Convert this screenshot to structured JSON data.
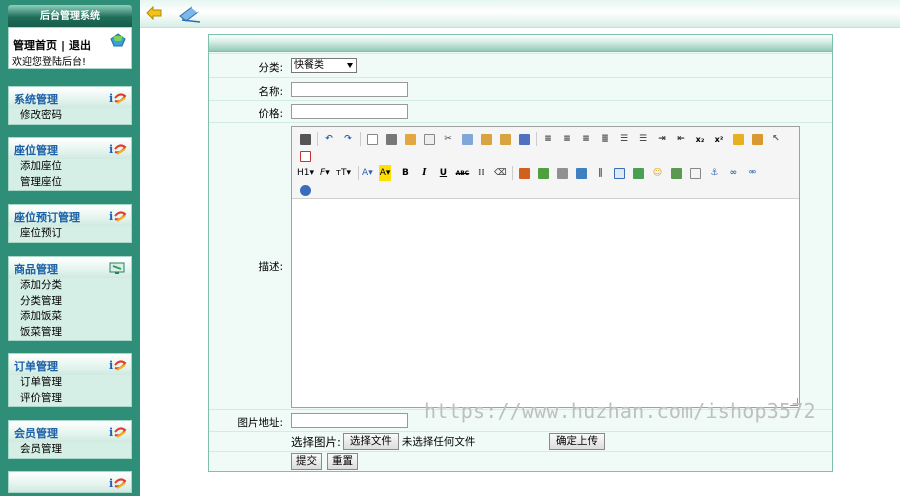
{
  "sidebar": {
    "title": "后台管理系统",
    "home": {
      "home_link": "管理首页",
      "separator": "|",
      "logout_link": "退出",
      "welcome": "欢迎您登陆后台!"
    },
    "groups": [
      {
        "title": "系统管理",
        "items": [
          "修改密码"
        ]
      },
      {
        "title": "座位管理",
        "items": [
          "添加座位",
          "管理座位"
        ]
      },
      {
        "title": "座位预订管理",
        "items": [
          "座位预订"
        ]
      },
      {
        "title": "商品管理",
        "items": [
          "添加分类",
          "分类管理",
          "添加饭菜",
          "饭菜管理"
        ]
      },
      {
        "title": "订单管理",
        "items": [
          "订单管理",
          "评价管理"
        ]
      },
      {
        "title": "会员管理",
        "items": [
          "会员管理"
        ]
      },
      {
        "title": "",
        "items": []
      }
    ]
  },
  "form": {
    "category_label": "分类:",
    "category_value": "快餐类",
    "name_label": "名称:",
    "name_value": "",
    "price_label": "价格:",
    "price_value": "",
    "desc_label": "描述:",
    "image_url_label": "图片地址:",
    "image_url_value": "",
    "choose_image_label": "选择图片:",
    "choose_file_button": "选择文件",
    "no_file_text": "未选择任何文件",
    "upload_button": "确定上传",
    "submit_button": "提交",
    "reset_button": "重置"
  },
  "editor": {
    "heading_dropdown": "H1",
    "font_dropdown": "F",
    "size_dropdown": "тT",
    "bold": "B",
    "italic": "I",
    "underline": "U",
    "strike": "ABC"
  },
  "watermark": "https://www.huzhan.com/ishop3572",
  "colors": {
    "sidebar_bg": "#2f8e78",
    "menu_title": "#1b5fa6",
    "panel_border": "#7fbfae"
  }
}
